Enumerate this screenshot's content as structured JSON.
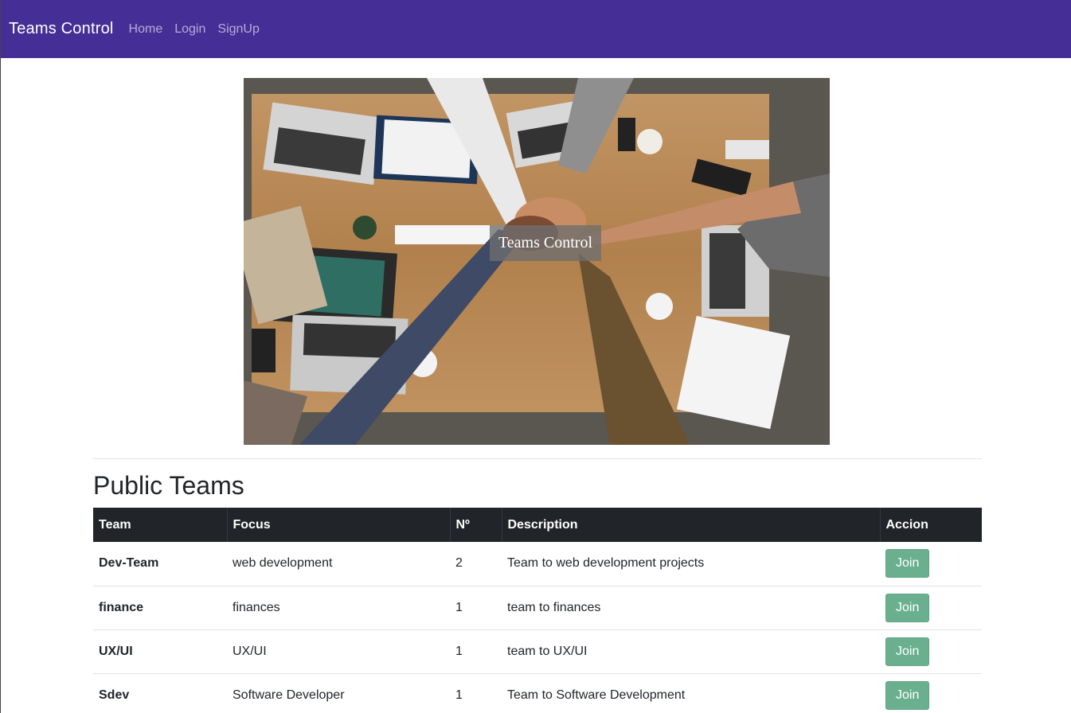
{
  "navbar": {
    "brand": "Teams Control",
    "links": [
      "Home",
      "Login",
      "SignUp"
    ],
    "background": "#452f96"
  },
  "hero": {
    "caption": "Teams Control"
  },
  "section": {
    "title": "Public Teams"
  },
  "table": {
    "headers": [
      "Team",
      "Focus",
      "Nº",
      "Description",
      "Accion"
    ],
    "rows": [
      {
        "team": "Dev-Team",
        "focus": "web development",
        "n": "2",
        "description": "Team to web development projects",
        "action": "Join"
      },
      {
        "team": "finance",
        "focus": "finances",
        "n": "1",
        "description": "team to finances",
        "action": "Join"
      },
      {
        "team": "UX/UI",
        "focus": "UX/UI",
        "n": "1",
        "description": "team to UX/UI",
        "action": "Join"
      },
      {
        "team": "Sdev",
        "focus": "Software Developer",
        "n": "1",
        "description": "Team to Software Development",
        "action": "Join"
      }
    ]
  },
  "colors": {
    "join_button": "#6ab08e",
    "table_header": "#212529"
  }
}
